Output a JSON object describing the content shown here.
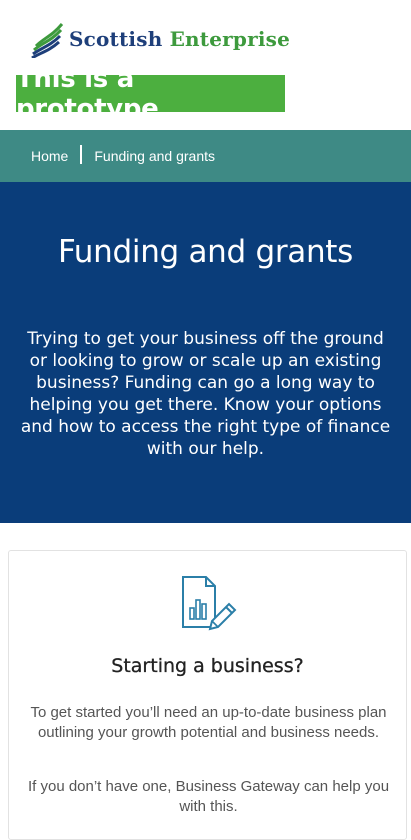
{
  "logo": {
    "word1": "Scottish",
    "word2": "Enterprise",
    "icon": "saltire-flag-icon",
    "colors": {
      "blue": "#1e3f7a",
      "green": "#3d9a3d"
    }
  },
  "banner": {
    "text": "This is a prototype",
    "color": "#4caf3f"
  },
  "breadcrumb": {
    "items": [
      "Home",
      "Funding and grants"
    ],
    "color": "#3e8a85"
  },
  "hero": {
    "title": "Funding and grants",
    "description": "Trying to get your business off the ground or looking to grow or scale up an existing business? Funding can go a long way to helping you get there. Know your options and how to access the right type of finance with our help.",
    "color": "#0a3d7a"
  },
  "card": {
    "icon": "document-chart-pencil-icon",
    "title": "Starting a business?",
    "paragraph1": "To get started you’ll need an up-to-date business plan outlining your growth potential and business needs.",
    "paragraph2": "If you don’t have one, Business Gateway can help you with this."
  }
}
